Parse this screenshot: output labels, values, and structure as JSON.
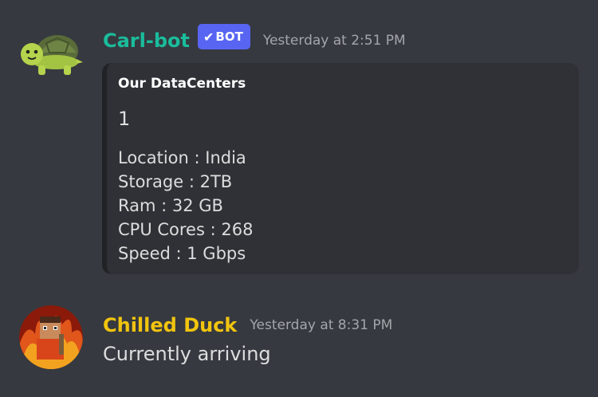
{
  "messages": [
    {
      "username": "Carl-bot",
      "username_color": "#1abc9c",
      "bot_badge": "BOT",
      "timestamp": "Yesterday at 2:51 PM",
      "avatar_icon": "turtle-avatar",
      "embed": {
        "title": "Our DataCenters",
        "field_name": "1",
        "lines": [
          "Location : India",
          "Storage : 2TB",
          "Ram : 32 GB",
          "CPU  Cores : 268",
          "Speed : 1 Gbps"
        ]
      }
    },
    {
      "username": "Chilled Duck",
      "username_color": "#f1c40f",
      "timestamp": "Yesterday at 8:31 PM",
      "avatar_icon": "fire-character-avatar",
      "content": "Currently arriving"
    }
  ],
  "colors": {
    "background": "#36393f",
    "embed_bg": "#2f3136",
    "bot_badge": "#5865f2",
    "text": "#dcddde",
    "muted": "#a3a6aa"
  }
}
